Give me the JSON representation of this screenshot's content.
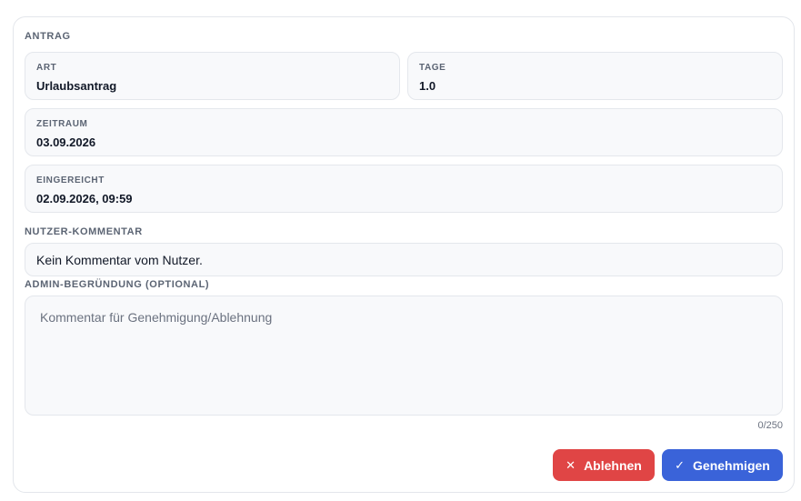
{
  "antrag": {
    "section_title": "ANTRAG",
    "art_label": "ART",
    "art_value": "Urlaubsantrag",
    "tage_label": "TAGE",
    "tage_value": "1.0",
    "zeitraum_label": "ZEITRAUM",
    "zeitraum_value": "03.09.2026",
    "eingereicht_label": "EINGEREICHT",
    "eingereicht_value": "02.09.2026, 09:59"
  },
  "comment": {
    "section_title": "NUTZER-KOMMENTAR",
    "text": "Kein Kommentar vom Nutzer."
  },
  "admin": {
    "section_title": "ADMIN-BEGRÜNDUNG (OPTIONAL)",
    "placeholder": "Kommentar für Genehmigung/Ablehnung",
    "value": "",
    "counter": "0/250"
  },
  "actions": {
    "reject_label": "Ablehnen",
    "reject_icon": "close-icon",
    "reject_color": "#e04545",
    "approve_label": "Genehmigen",
    "approve_icon": "check-icon",
    "approve_color": "#3a63d9"
  }
}
